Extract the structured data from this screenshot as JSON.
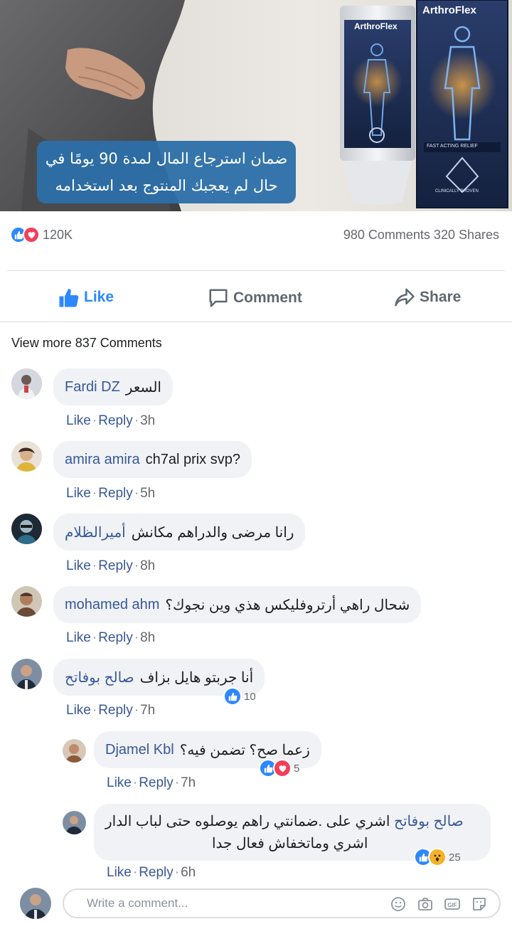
{
  "ad": {
    "brand": "ArthroFlex",
    "tube_brand": "ArthroFlex",
    "box_label": "FAST ACTING RELIEF",
    "box_sub": "CLINICALLY PROVEN",
    "caption_line1": "ضمان استرجاع المال لمدة 90 يومًا في",
    "caption_line2": "حال لم يعجبك المنتوج بعد استخدامه"
  },
  "stats": {
    "reaction_count": "120K",
    "comments_shares": "980 Comments 320 Shares"
  },
  "actions": {
    "like": "Like",
    "comment": "Comment",
    "share": "Share"
  },
  "view_more": "View more 837 Comments",
  "meta_labels": {
    "like": "Like",
    "reply": "Reply",
    "dot": "·"
  },
  "comments": [
    {
      "name": "Fardi DZ",
      "text": "السعر",
      "time": "3h"
    },
    {
      "name": "amira amira",
      "text": "ch7al prix svp?",
      "time": "5h"
    },
    {
      "name": "أميرالظلام",
      "text": "رانا مرضى والدراهم مكانش",
      "time": "8h"
    },
    {
      "name": "mohamed ahm",
      "text": "شحال راهي أرتروفليكس هذي وين نجوك؟",
      "time": "8h"
    },
    {
      "name": "صالح بوفاتح",
      "text": "أنا جربتو هايل بزاف",
      "time": "7h",
      "reactions": "10"
    }
  ],
  "replies": [
    {
      "name": "Djamel Kbl",
      "text": "زعما صح؟ تضمن فيه؟",
      "time": "7h",
      "reactions": "5"
    },
    {
      "name": "صالح بوفاتح",
      "text_line1": "اشري على .ضمانتي راهم يوصلوه حتى لباب الدار",
      "text_line2": "اشري وماتخفاش فعال جدا",
      "time": "6h",
      "reactions": "25"
    }
  ],
  "composer": {
    "placeholder": "Write a comment..."
  },
  "colors": {
    "link": "#385898",
    "like_blue": "#2d88ff",
    "love_red": "#f33e58",
    "caption_bg": "#2b6fa8"
  }
}
